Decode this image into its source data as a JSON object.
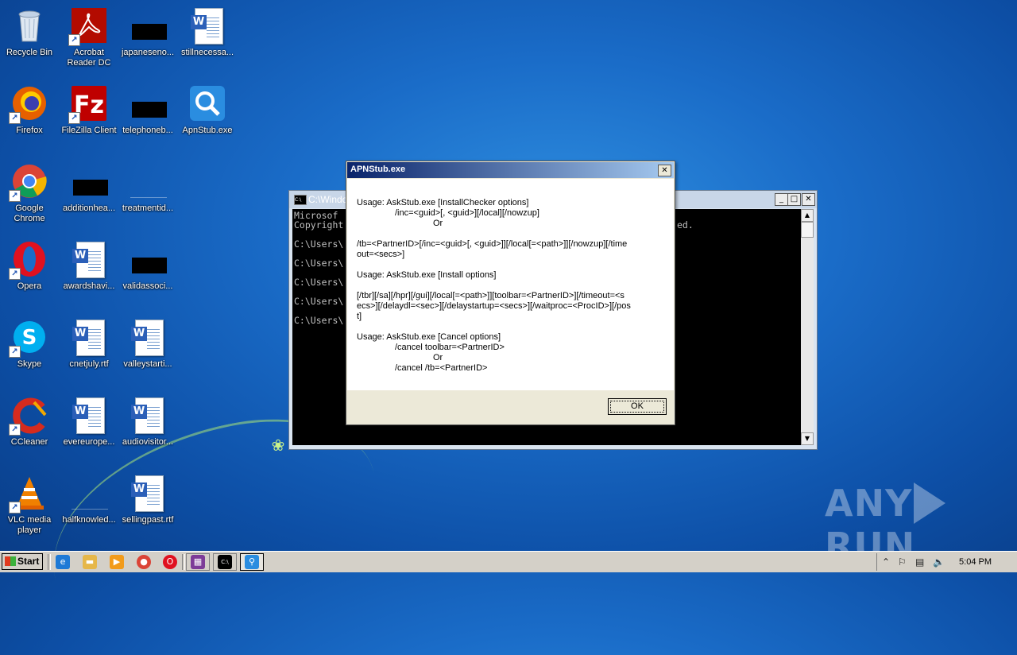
{
  "desktop": {
    "icons": [
      {
        "label": "Recycle Bin",
        "icon": "recycle-bin-icon"
      },
      {
        "label": "Acrobat Reader DC",
        "icon": "acrobat-icon"
      },
      {
        "label": "japaneseno...",
        "icon": "redacted-icon"
      },
      {
        "label": "stillnecessa...",
        "icon": "word-doc-icon"
      },
      {
        "label": "Firefox",
        "icon": "firefox-icon"
      },
      {
        "label": "FileZilla Client",
        "icon": "filezilla-icon"
      },
      {
        "label": "telephoneb...",
        "icon": "redacted-icon"
      },
      {
        "label": "ApnStub.exe",
        "icon": "magnifier-icon"
      },
      {
        "label": "Google Chrome",
        "icon": "chrome-icon"
      },
      {
        "label": "additionhea...",
        "icon": "redacted-icon"
      },
      {
        "label": "treatmentid...",
        "icon": "blank-icon"
      },
      {
        "label": "Opera",
        "icon": "opera-icon"
      },
      {
        "label": "awardshavi...",
        "icon": "word-doc-icon"
      },
      {
        "label": "validassoci...",
        "icon": "redacted-icon"
      },
      {
        "label": "Skype",
        "icon": "skype-icon"
      },
      {
        "label": "cnetjuly.rtf",
        "icon": "word-doc-icon"
      },
      {
        "label": "valleystarti...",
        "icon": "word-doc-icon"
      },
      {
        "label": "CCleaner",
        "icon": "ccleaner-icon"
      },
      {
        "label": "evereurope...",
        "icon": "word-doc-icon"
      },
      {
        "label": "audiovisitor...",
        "icon": "word-doc-icon"
      },
      {
        "label": "VLC media player",
        "icon": "vlc-icon"
      },
      {
        "label": "halfknowled...",
        "icon": "blank-icon"
      },
      {
        "label": "sellingpast.rtf",
        "icon": "word-doc-icon"
      }
    ]
  },
  "console": {
    "title": "C:\\Windo",
    "lines": [
      "Microsof",
      "Copyright",
      "C:\\Users\\",
      "C:\\Users\\",
      "C:\\Users\\",
      "C:\\Users\\",
      "C:\\Users\\"
    ],
    "partial_right": "ed."
  },
  "dialog": {
    "title": "APNStub.exe",
    "close": "✕",
    "lines": [
      "Usage:     AskStub.exe [InstallChecker options]",
      "/inc=<guid>[, <guid>][/local][/nowzup]",
      "Or",
      "/tb=<PartnerID>[/inc=<guid>[, <guid>]][/local[=<path>]][/nowzup][/time",
      "out=<secs>]",
      "Usage:     AskStub.exe [Install options]",
      "[/tbr][/sa][/hpr][/gui][/local[=<path>]][toolbar=<PartnerID>][/timeout=<s",
      "ecs>][/delaydl=<sec>][/delaystartup=<secs>][/waitproc=<ProcID>][/pos",
      "t]",
      "Usage:     AskStub.exe [Cancel options]",
      "/cancel toolbar=<PartnerID>",
      "Or",
      "/cancel /tb=<PartnerID>"
    ],
    "ok_label": "OK"
  },
  "taskbar": {
    "start_label": "Start",
    "quick_launch": [
      "ie-icon",
      "explorer-folder-icon",
      "media-player-icon",
      "chrome-icon",
      "opera-icon"
    ],
    "tasks": [
      "winrar-icon",
      "console-icon",
      "search-icon"
    ],
    "clock": "5:04 PM"
  },
  "watermark": {
    "left": "ANY",
    "right": "RUN"
  },
  "colors": {
    "desktop": "#1a6cc8",
    "dialog_title": "#0a246a",
    "taskbar": "#d4d0c8"
  }
}
